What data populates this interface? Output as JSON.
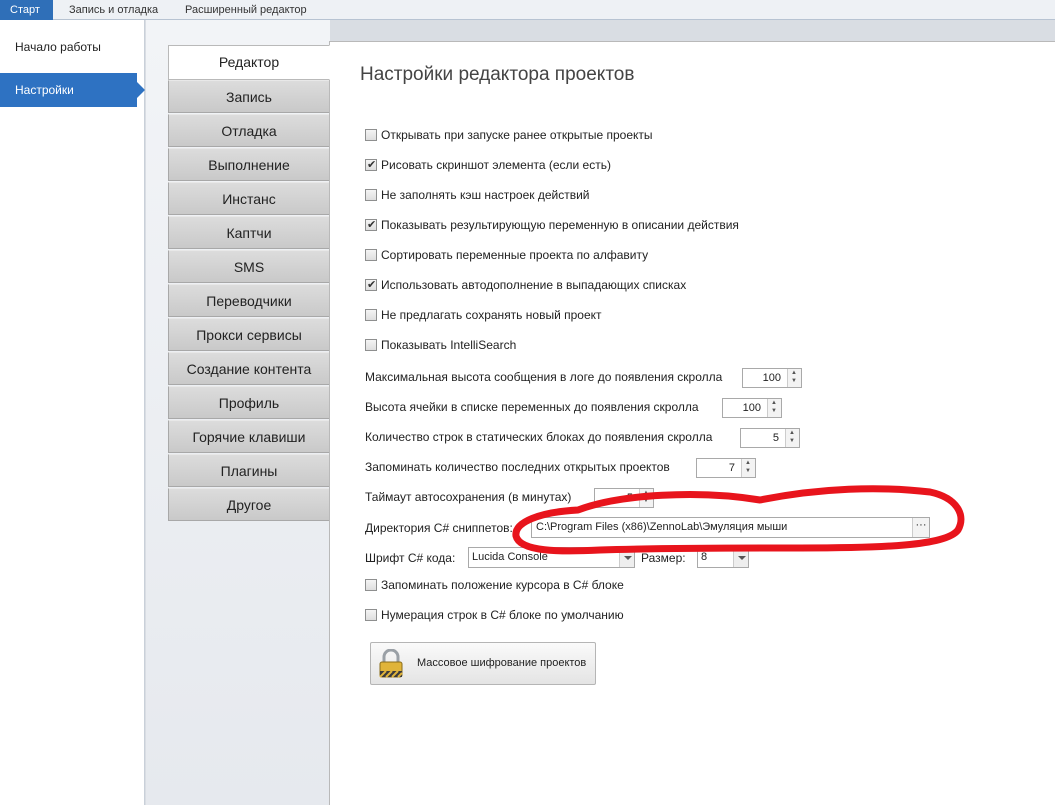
{
  "top_tabs": [
    "Старт",
    "Запись и отладка",
    "Расширенный редактор"
  ],
  "left_nav": [
    "Начало работы",
    "Настройки"
  ],
  "vertical_tabs": [
    "Редактор",
    "Запись",
    "Отладка",
    "Выполнение",
    "Инстанс",
    "Каптчи",
    "SMS",
    "Переводчики",
    "Прокси сервисы",
    "Создание контента",
    "Профиль",
    "Горячие клавиши",
    "Плагины",
    "Другое"
  ],
  "panel": {
    "title": "Настройки редактора проектов",
    "checkboxes": [
      {
        "label": "Открывать при запуске ранее открытые проекты",
        "checked": false
      },
      {
        "label": "Рисовать скриншот элемента (если есть)",
        "checked": true
      },
      {
        "label": "Не заполнять кэш настроек действий",
        "checked": false
      },
      {
        "label": "Показывать результирующую переменную в описании действия",
        "checked": true
      },
      {
        "label": "Сортировать переменные проекта по алфавиту",
        "checked": false
      },
      {
        "label": "Использовать автодополнение в выпадающих списках",
        "checked": true
      },
      {
        "label": "Не предлагать сохранять новый проект",
        "checked": false
      },
      {
        "label": "Показывать IntelliSearch",
        "checked": false
      }
    ],
    "numeric": [
      {
        "label": "Максимальная высота сообщения в логе до появления скролла",
        "value": "100"
      },
      {
        "label": "Высота ячейки в списке переменных до появления скролла",
        "value": "100"
      },
      {
        "label": "Количество строк в статических блоках до появления скролла",
        "value": "5"
      },
      {
        "label": "Запоминать количество последних открытых проектов",
        "value": "7"
      },
      {
        "label": "Таймаут автосохранения (в минутах)",
        "value": "5"
      }
    ],
    "snippets_label": "Директория C# сниппетов:",
    "snippets_path": "C:\\Program Files (x86)\\ZennoLab\\Эмуляция мыши",
    "browse_label": "···",
    "font_label": "Шрифт C# кода:",
    "font_value": "Lucida Console",
    "size_label": "Размер:",
    "size_value": "8",
    "checkboxes2": [
      {
        "label": "Запоминать положение курсора в C# блоке",
        "checked": false
      },
      {
        "label": "Нумерация строк в C# блоке по умолчанию",
        "checked": false
      }
    ],
    "encrypt_button": "Массовое шифрование проектов"
  },
  "colors": {
    "accent": "#2e72c2",
    "annotation": "#e8141c"
  }
}
